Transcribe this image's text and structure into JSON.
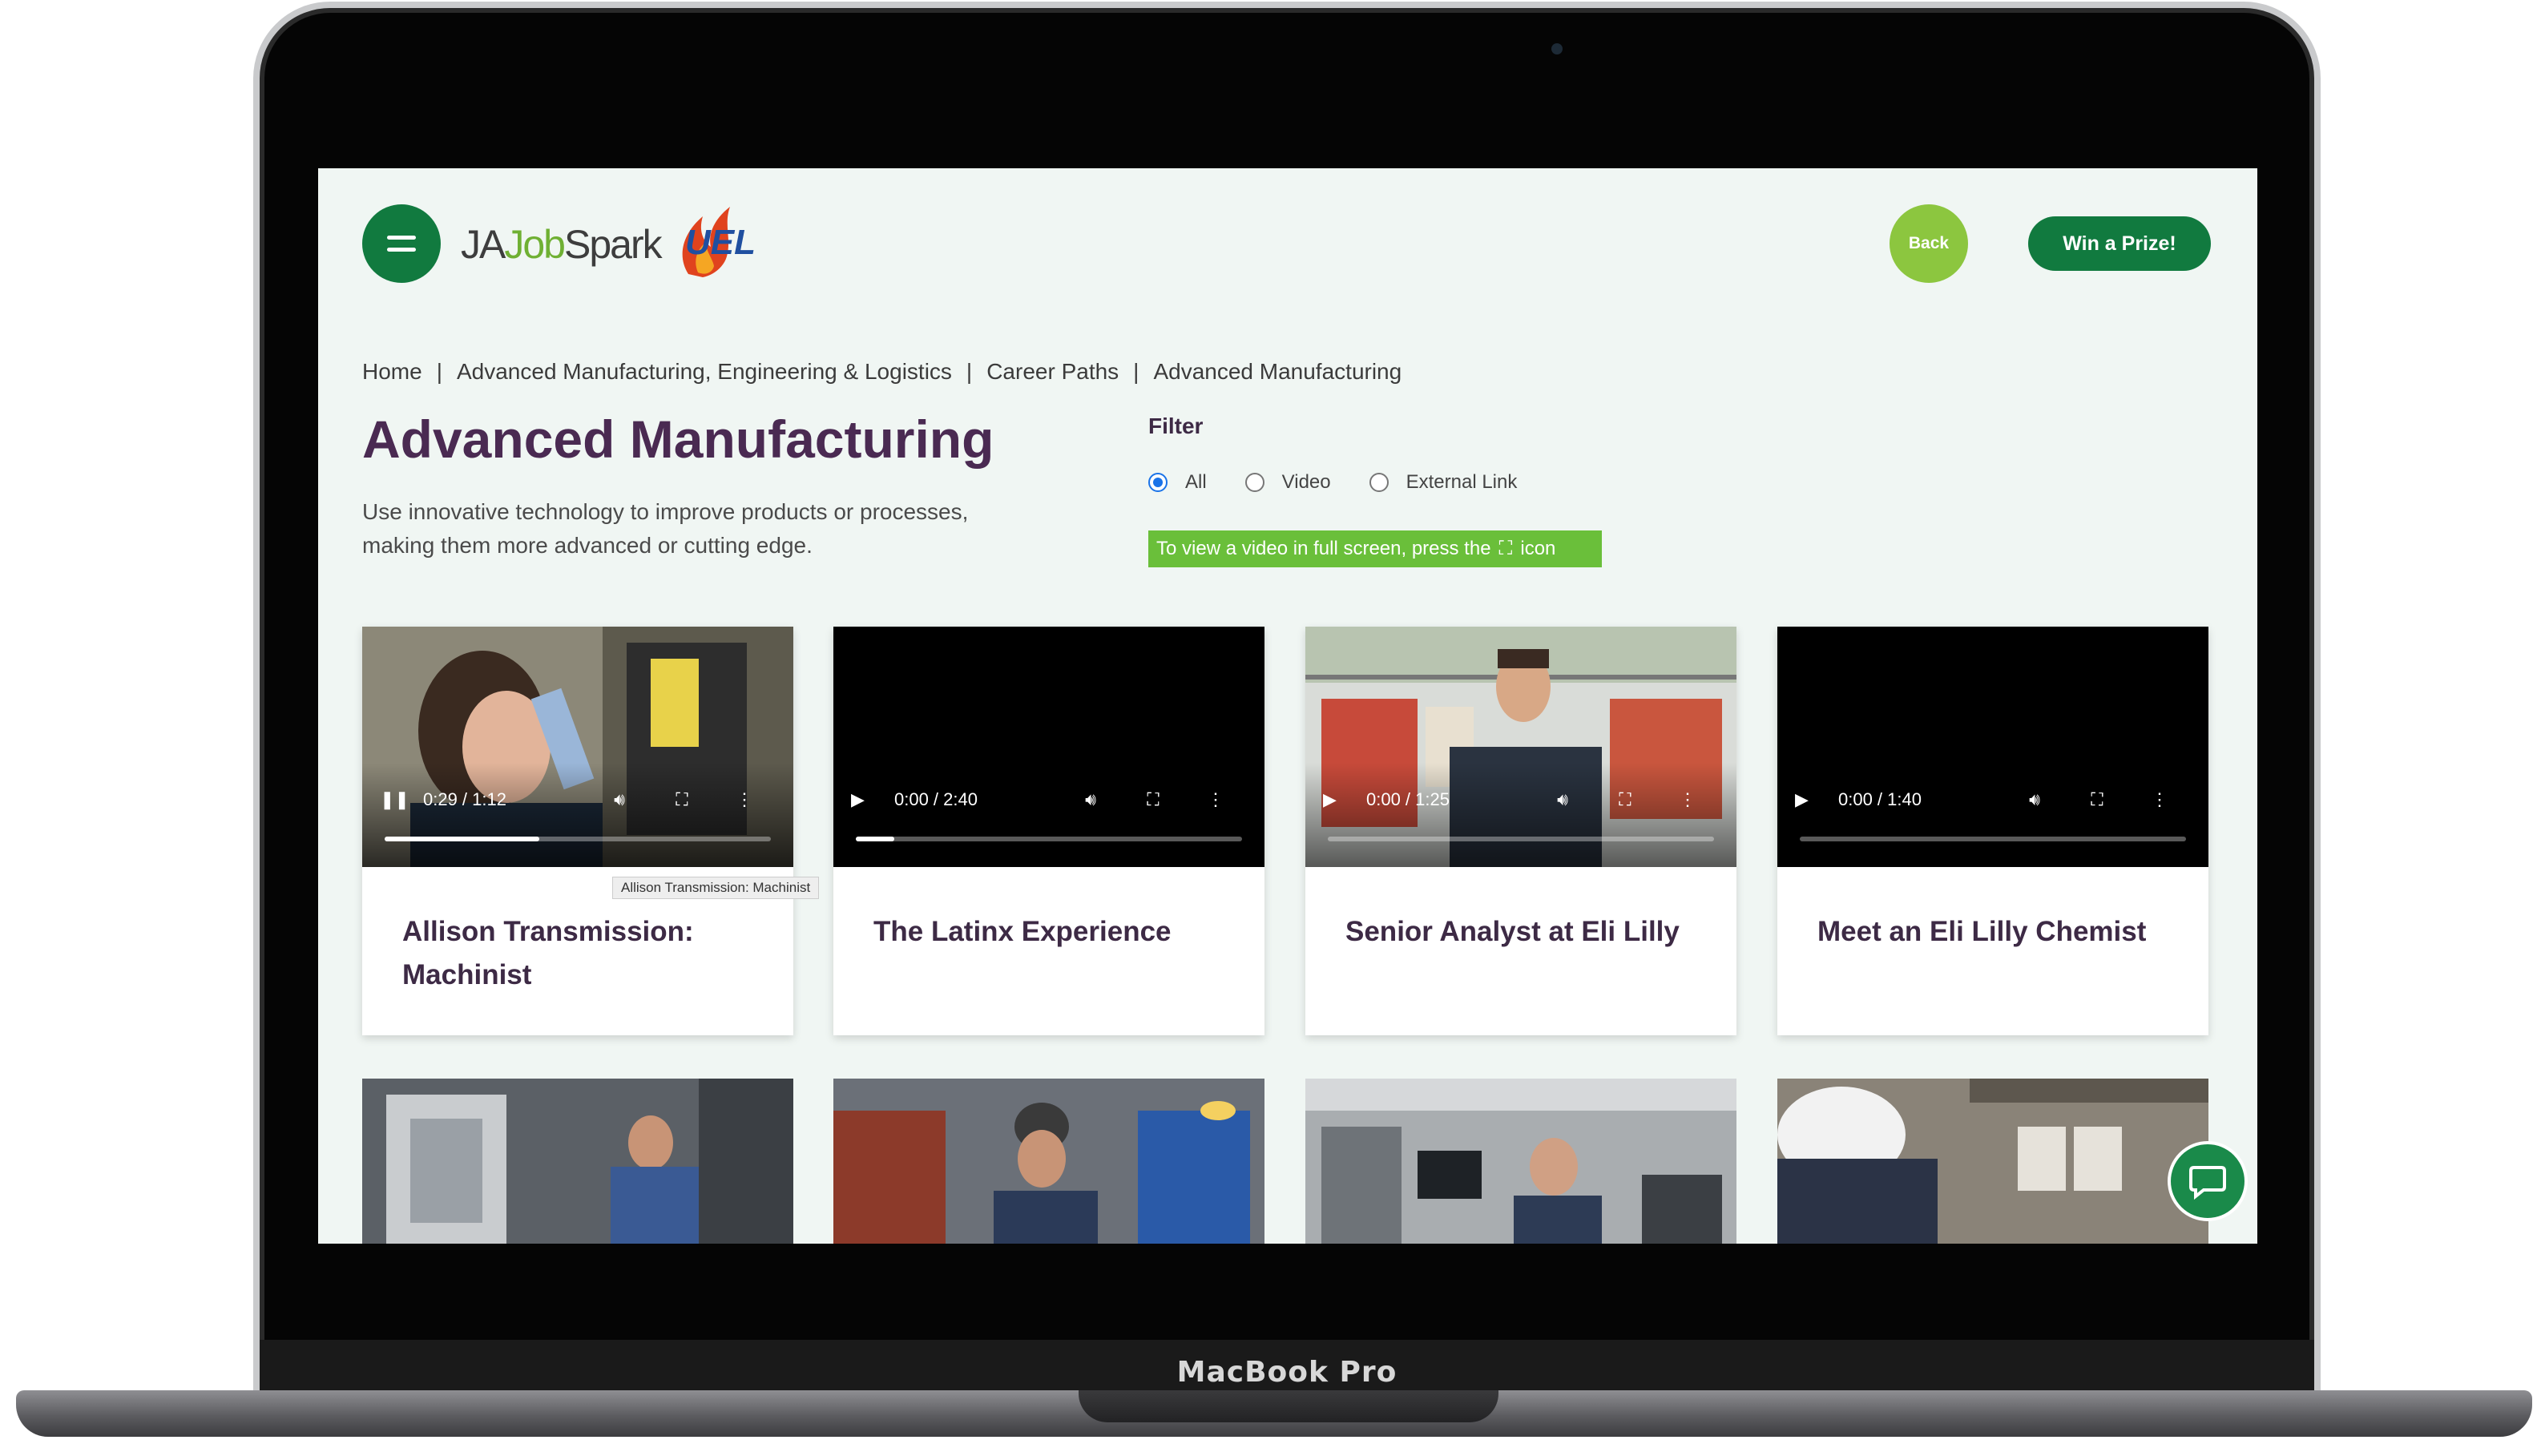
{
  "device": {
    "label": "MacBook Pro"
  },
  "header": {
    "logo": {
      "ja": "JA",
      "job": "Job",
      "spark": "Spark",
      "partner": "UEL"
    },
    "back_label": "Back",
    "prize_label": "Win a Prize!"
  },
  "breadcrumb": {
    "separator": "|",
    "items": [
      "Home",
      "Advanced Manufacturing, Engineering & Logistics",
      "Career Paths",
      "Advanced Manufacturing"
    ]
  },
  "page": {
    "title": "Advanced Manufacturing",
    "description": "Use innovative technology to improve products or processes, making them more advanced or cutting edge."
  },
  "filter": {
    "label": "Filter",
    "options": [
      "All",
      "Video",
      "External Link"
    ],
    "selected": "All",
    "notice_before": "To view a video in full screen, press the",
    "notice_after": "icon"
  },
  "cards": [
    {
      "title": "Allison Transmission: Machinist",
      "time": "0:29 / 1:12",
      "playing": true,
      "progress": 0.4,
      "tooltip": "Allison Transmission: Machinist"
    },
    {
      "title": "The Latinx Experience",
      "time": "0:00 / 2:40",
      "playing": false,
      "progress": 0.1
    },
    {
      "title": "Senior Analyst at Eli Lilly",
      "time": "0:00 / 1:25",
      "playing": false,
      "progress": 0.0
    },
    {
      "title": "Meet an Eli Lilly Chemist",
      "time": "0:00 / 1:40",
      "playing": false,
      "progress": 0.0
    }
  ],
  "colors": {
    "brand_green": "#117a3f",
    "light_green": "#8cc63f",
    "notice_green": "#6abf3a",
    "title_purple": "#4a2a52",
    "page_bg": "#f0f6f3"
  },
  "icons": [
    "menu-icon",
    "play-icon",
    "pause-icon",
    "volume-icon",
    "fullscreen-icon",
    "more-vert-icon",
    "chat-icon"
  ]
}
